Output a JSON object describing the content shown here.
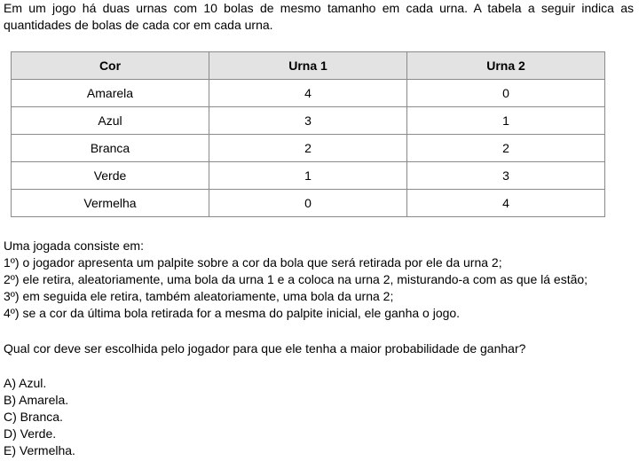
{
  "intro": "Em um jogo há duas urnas com 10 bolas de mesmo tamanho em cada urna. A tabela a seguir indica as quantidades de bolas de cada cor em cada urna.",
  "table": {
    "headers": [
      "Cor",
      "Urna 1",
      "Urna 2"
    ],
    "rows": [
      [
        "Amarela",
        "4",
        "0"
      ],
      [
        "Azul",
        "3",
        "1"
      ],
      [
        "Branca",
        "2",
        "2"
      ],
      [
        "Verde",
        "1",
        "3"
      ],
      [
        "Vermelha",
        "0",
        "4"
      ]
    ]
  },
  "rules": {
    "heading": "Uma jogada consiste em:",
    "steps": [
      "1º) o jogador apresenta um palpite sobre a cor da bola que será retirada por ele da urna 2;",
      "2º) ele retira, aleatoriamente, uma bola da urna 1 e a coloca na urna 2, misturando-a com as que lá estão;",
      "3º) em seguida ele retira, também aleatoriamente, uma bola da urna 2;",
      "4º) se a cor da última bola retirada for a mesma do palpite inicial, ele ganha o jogo."
    ]
  },
  "question": "Qual cor deve ser escolhida pelo jogador para que ele tenha a maior probabilidade de ganhar?",
  "options": [
    "A) Azul.",
    "B) Amarela.",
    "C) Branca.",
    "D) Verde.",
    "E) Vermelha."
  ]
}
